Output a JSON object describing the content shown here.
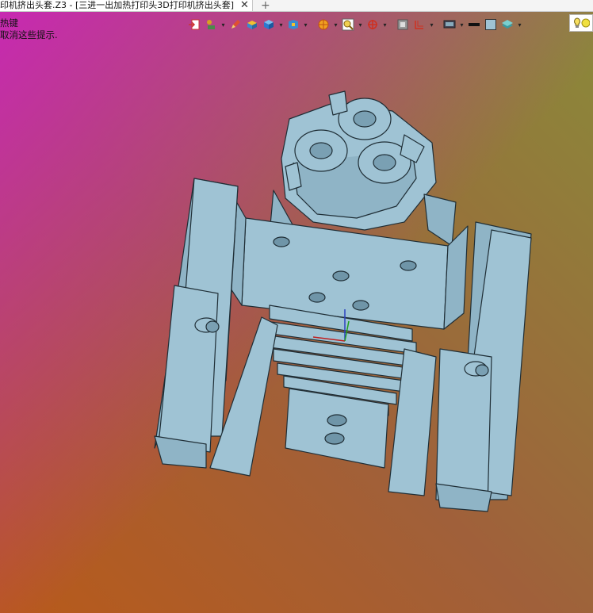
{
  "window": {
    "active_tab_title": "印机挤出头套.Z3 - [三进一出加热打印头3D打印机挤出头套]",
    "new_tab_symbol": "+"
  },
  "hint": {
    "line1": "热键",
    "line2": "取消这些提示."
  },
  "toolbar": {
    "icons": [
      "import-icon",
      "measure-icon",
      "edit-icon",
      "box-display-icon",
      "cube-view-icon",
      "view-orient-icon",
      "render-mode-icon",
      "zoom-icon",
      "axis-icon",
      "grid-icon",
      "section-icon",
      "display-icon",
      "line-style-icon",
      "color-icon",
      "layer-icon",
      "light-icon"
    ]
  },
  "colors": {
    "model_fill": "#9fc3d4",
    "model_stroke": "#1f2e36",
    "bg_top_left": "#c928b4",
    "bg_bottom_left": "#b85a1a",
    "bg_top_right": "#8a9a3a"
  }
}
